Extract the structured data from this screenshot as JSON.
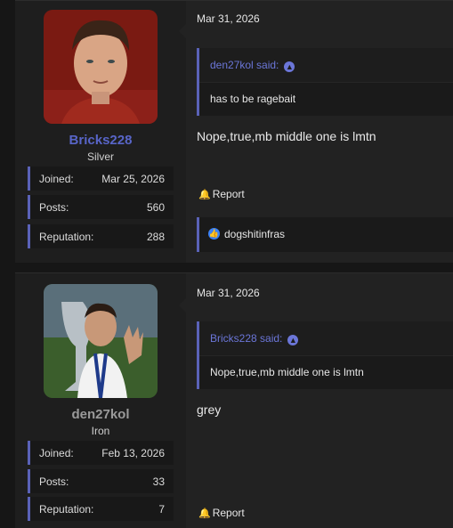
{
  "posts": [
    {
      "user": {
        "name": "Bricks228",
        "rank": "Silver",
        "stats": [
          {
            "label": "Joined:",
            "value": "Mar 25, 2026"
          },
          {
            "label": "Posts:",
            "value": "560"
          },
          {
            "label": "Reputation:",
            "value": "288"
          }
        ]
      },
      "date": "Mar 31, 2026",
      "quote": {
        "author": "den27kol said:",
        "text": "has to be ragebait"
      },
      "message": "Nope,true,mb middle one is lmtn",
      "report_label": "Report",
      "reactions": {
        "users": "dogshitinfras"
      }
    },
    {
      "user": {
        "name": "den27kol",
        "rank": "Iron",
        "stats": [
          {
            "label": "Joined:",
            "value": "Feb 13, 2026"
          },
          {
            "label": "Posts:",
            "value": "33"
          },
          {
            "label": "Reputation:",
            "value": "7"
          }
        ]
      },
      "date": "Mar 31, 2026",
      "quote": {
        "author": "Bricks228 said:",
        "text": "Nope,true,mb middle one is lmtn"
      },
      "message": "grey",
      "report_label": "Report"
    }
  ],
  "icons": {
    "bell": "bell-icon",
    "up": "arrow-up-circle-icon",
    "like": "thumbs-up-icon"
  },
  "colors": {
    "accent": "#5a62b8",
    "link": "#6b76d8",
    "like": "#3b82f6"
  }
}
